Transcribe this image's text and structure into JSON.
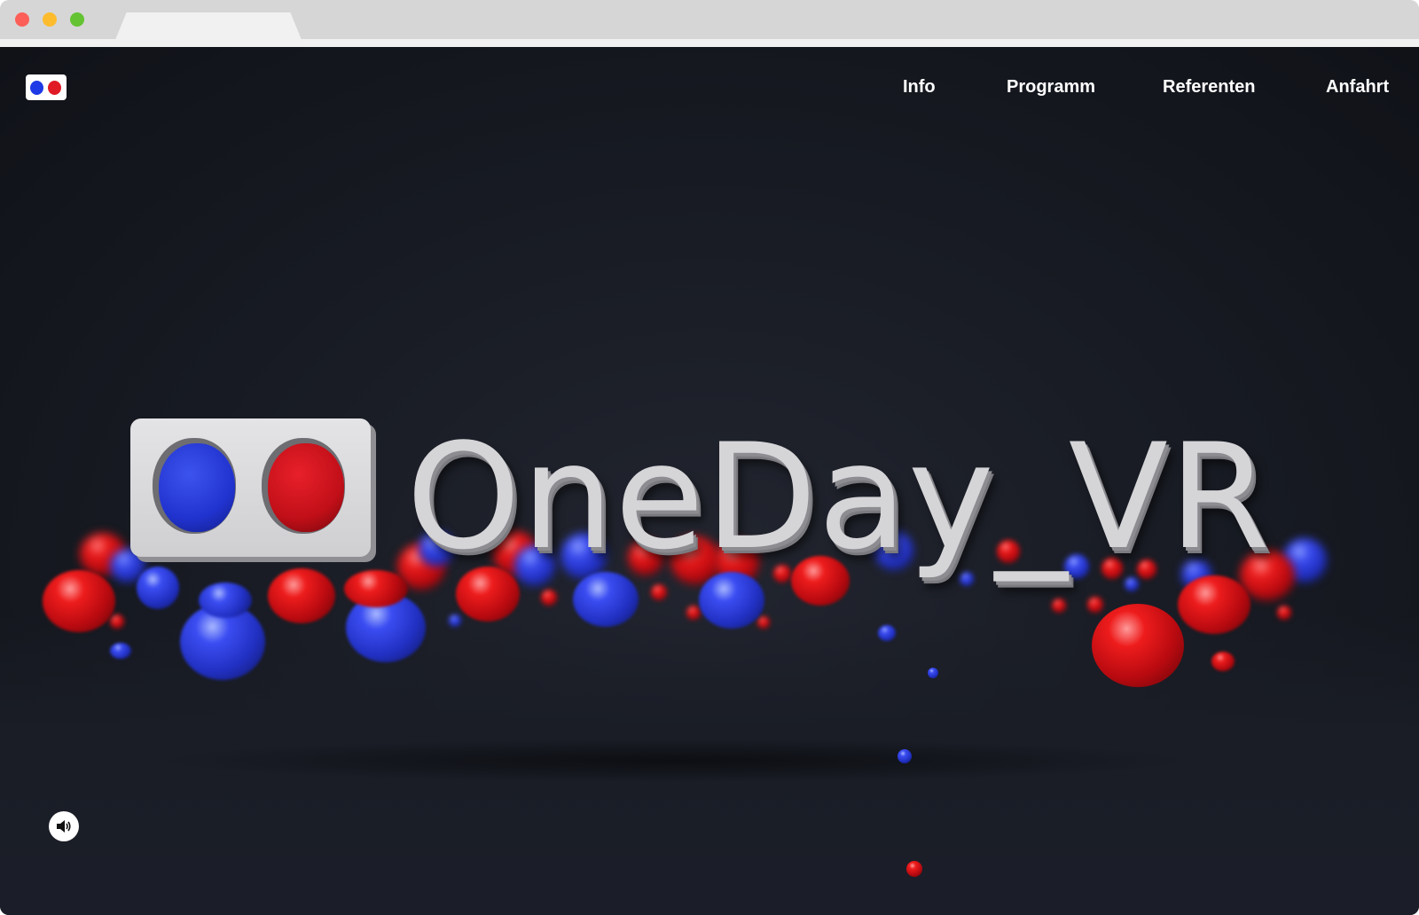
{
  "browser": {
    "tab_title": ""
  },
  "nav": {
    "logo_icon": "stereo-glasses-logo-icon",
    "links": [
      "Info",
      "Programm",
      "Referenten",
      "Anfahrt"
    ]
  },
  "hero": {
    "title": "OneDay_VR",
    "logo_icon": "stereo-glasses-logo-icon",
    "background": "red-and-blue-spheres-3d-scene"
  },
  "controls": {
    "sound_icon": "speaker-volume-icon"
  },
  "colors": {
    "background_dark": "#171a22",
    "accent_red": "#e01b25",
    "accent_blue": "#1e39e6",
    "nav_text": "#ffffff",
    "logo_face": "#d5d5d8"
  }
}
